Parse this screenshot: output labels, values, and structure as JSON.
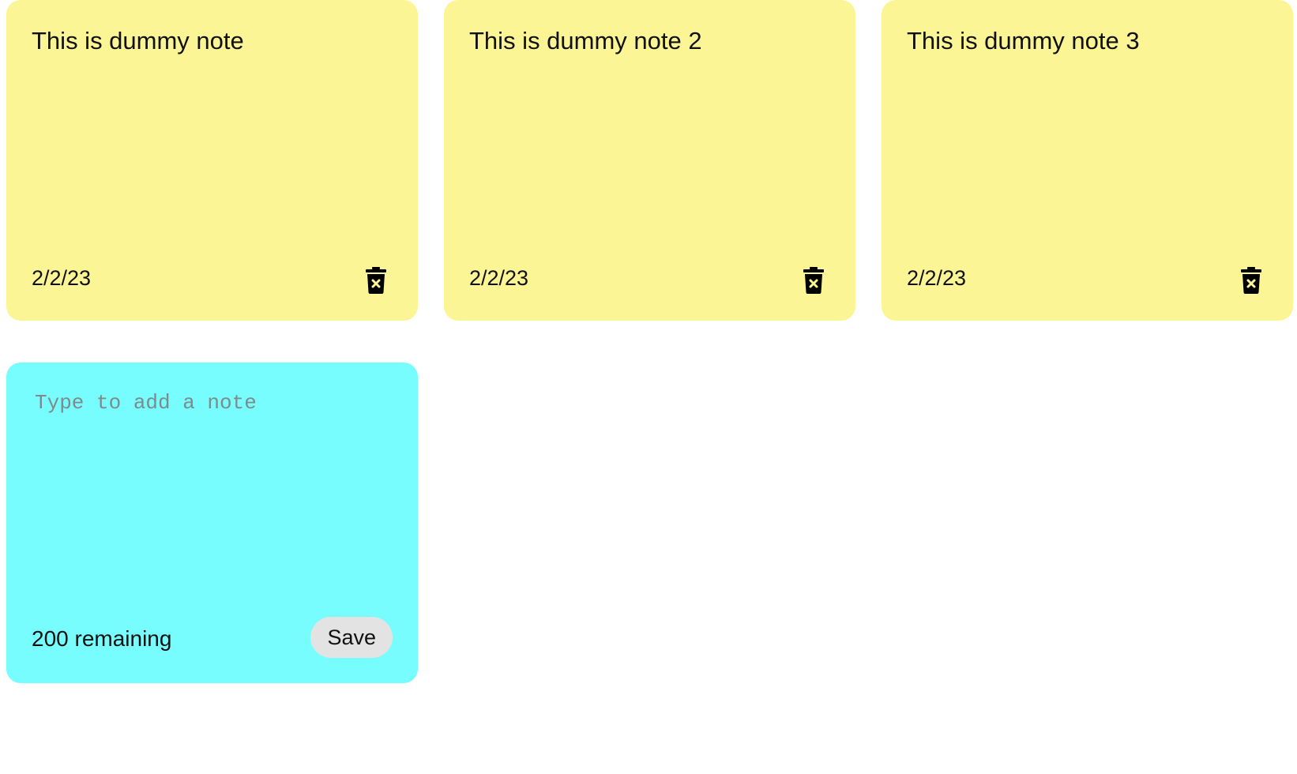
{
  "notes": [
    {
      "text": "This is dummy note",
      "date": "2/2/23",
      "delete_icon": "trash-x-icon"
    },
    {
      "text": "This is dummy note 2",
      "date": "2/2/23",
      "delete_icon": "trash-x-icon"
    },
    {
      "text": "This is dummy note 3",
      "date": "2/2/23",
      "delete_icon": "trash-x-icon"
    }
  ],
  "new_note": {
    "placeholder": "Type to add a note",
    "value": "",
    "remaining_text": "200 remaining",
    "save_label": "Save"
  },
  "colors": {
    "note_background": "#fcf596",
    "new_note_background": "#77fdfe",
    "save_button_background": "#e3e3e3"
  }
}
